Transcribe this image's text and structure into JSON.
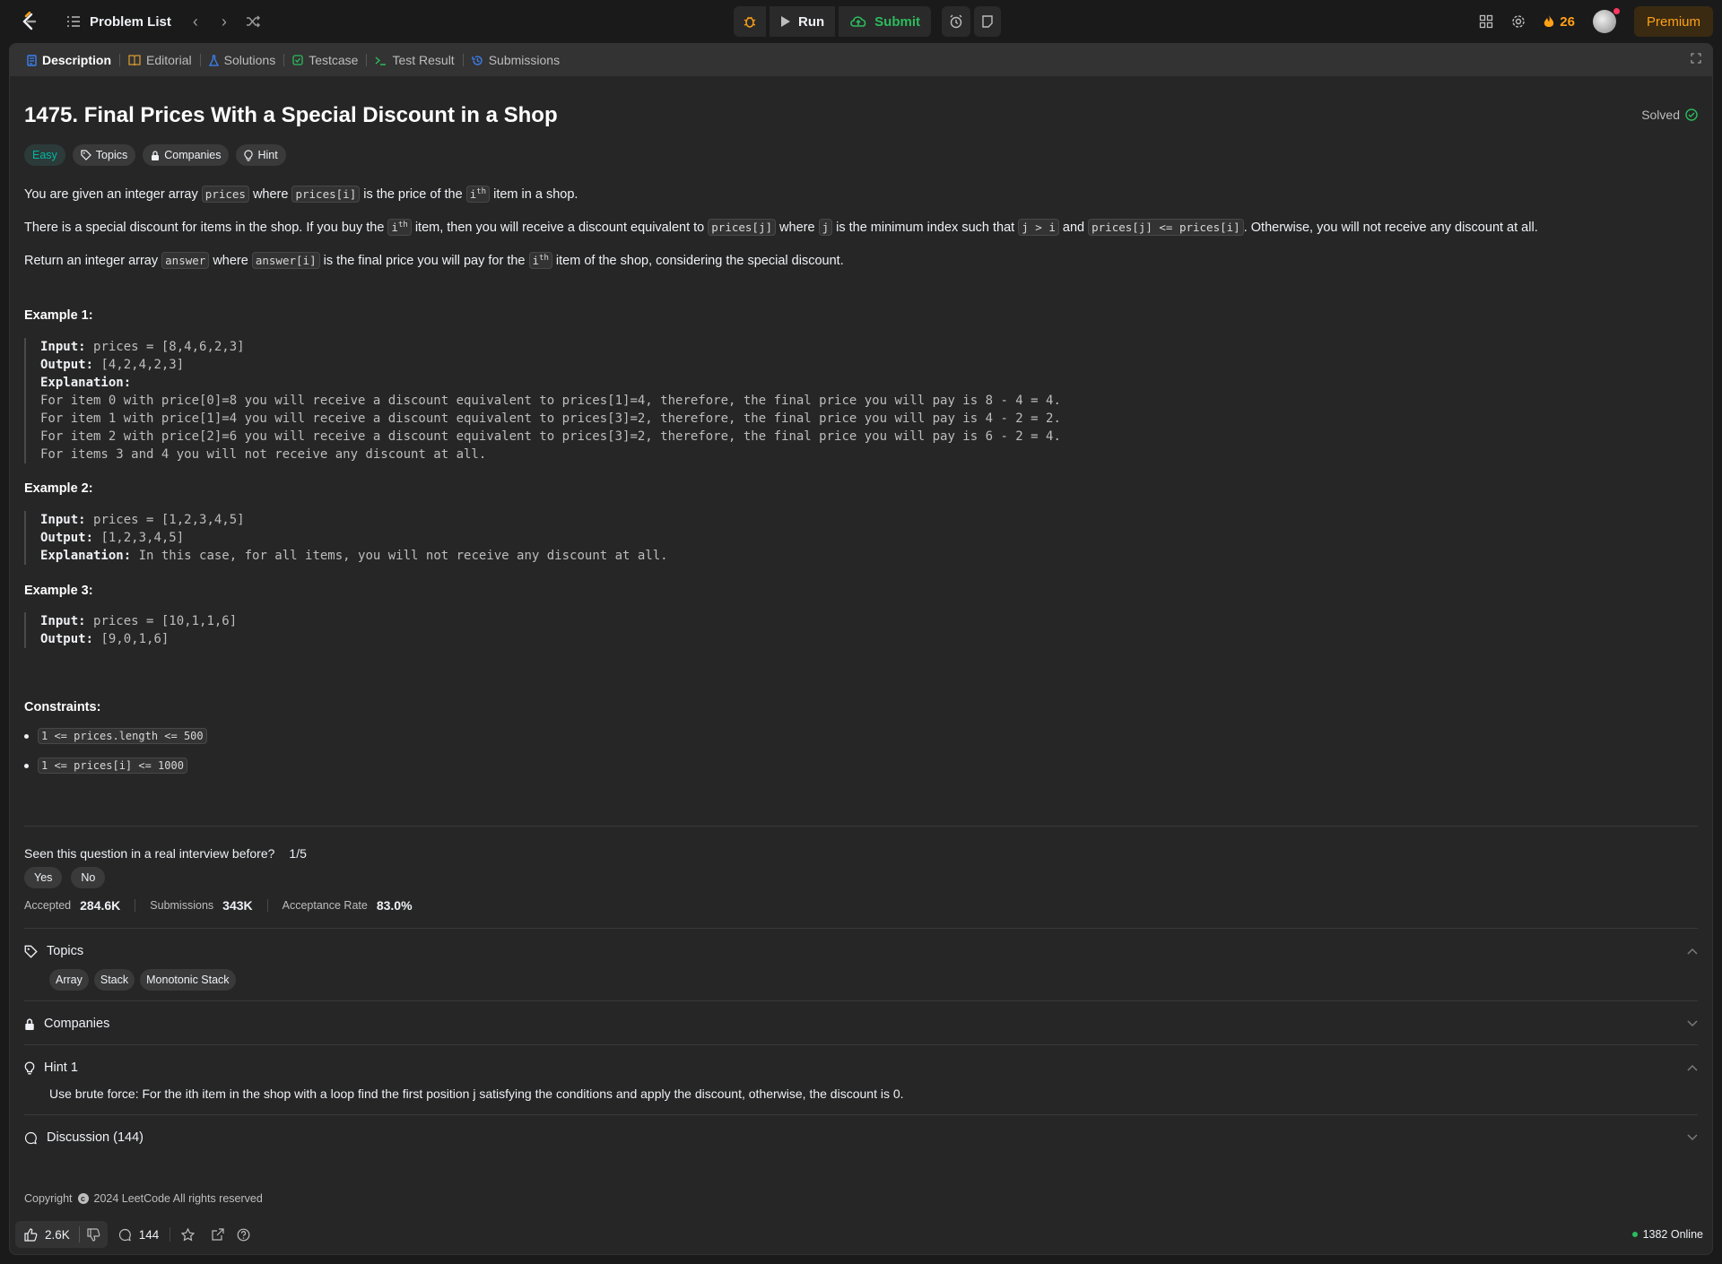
{
  "topbar": {
    "problem_list_label": "Problem List",
    "run_label": "Run",
    "submit_label": "Submit",
    "streak_count": "26",
    "premium_label": "Premium"
  },
  "tabs": [
    {
      "label": "Description",
      "icon": "description-icon",
      "active": true
    },
    {
      "label": "Editorial",
      "icon": "book-icon"
    },
    {
      "label": "Solutions",
      "icon": "flask-icon"
    },
    {
      "label": "Testcase",
      "icon": "checkbox-icon"
    },
    {
      "label": "Test Result",
      "icon": "terminal-icon"
    },
    {
      "label": "Submissions",
      "icon": "history-icon"
    }
  ],
  "problem": {
    "title": "1475. Final Prices With a Special Discount in a Shop",
    "solved_label": "Solved",
    "difficulty": "Easy",
    "badges": {
      "topics": "Topics",
      "companies": "Companies",
      "hint": "Hint"
    },
    "p1": {
      "a": "You are given an integer array",
      "c1": "prices",
      "b": "where",
      "c2": "prices[i]",
      "c": "is the price of the",
      "c3": "i",
      "sup": "th",
      "d": "item in a shop."
    },
    "p2": {
      "a": "There is a special discount for items in the shop. If you buy the",
      "c1": "i",
      "sup": "th",
      "b": "item, then you will receive a discount equivalent to",
      "c2": "prices[j]",
      "c": "where",
      "c3": "j",
      "d": "is the minimum index such that",
      "c4": "j > i",
      "e": "and",
      "c5": "prices[j] <= prices[i]",
      "f": ". Otherwise, you will not receive any discount at all."
    },
    "p3": {
      "a": "Return an integer array",
      "c1": "answer",
      "b": "where",
      "c2": "answer[i]",
      "c": "is the final price you will pay for the",
      "c3": "i",
      "sup": "th",
      "d": "item of the shop, considering the special discount."
    }
  },
  "examples": [
    {
      "title": "Example 1:",
      "input_label": "Input:",
      "input": "prices = [8,4,6,2,3]",
      "output_label": "Output:",
      "output": "[4,2,4,2,3]",
      "explanation_label": "Explanation:",
      "explanation_lines": [
        "For item 0 with price[0]=8 you will receive a discount equivalent to prices[1]=4, therefore, the final price you will pay is 8 - 4 = 4.",
        "For item 1 with price[1]=4 you will receive a discount equivalent to prices[3]=2, therefore, the final price you will pay is 4 - 2 = 2.",
        "For item 2 with price[2]=6 you will receive a discount equivalent to prices[3]=2, therefore, the final price you will pay is 6 - 2 = 4.",
        "For items 3 and 4 you will not receive any discount at all."
      ]
    },
    {
      "title": "Example 2:",
      "input_label": "Input:",
      "input": "prices = [1,2,3,4,5]",
      "output_label": "Output:",
      "output": "[1,2,3,4,5]",
      "explanation_label": "Explanation:",
      "explanation": "In this case, for all items, you will not receive any discount at all."
    },
    {
      "title": "Example 3:",
      "input_label": "Input:",
      "input": "prices = [10,1,1,6]",
      "output_label": "Output:",
      "output": "[9,0,1,6]"
    }
  ],
  "constraints": {
    "title": "Constraints:",
    "items": [
      "1 <= prices.length <= 500",
      "1 <= prices[i] <= 1000"
    ]
  },
  "interview": {
    "question": "Seen this question in a real interview before?",
    "ratio": "1/5",
    "yes": "Yes",
    "no": "No"
  },
  "stats": {
    "accepted_label": "Accepted",
    "accepted": "284.6K",
    "submissions_label": "Submissions",
    "submissions": "343K",
    "rate_label": "Acceptance Rate",
    "rate": "83.0%"
  },
  "sections": {
    "topics": {
      "label": "Topics",
      "items": [
        "Array",
        "Stack",
        "Monotonic Stack"
      ]
    },
    "companies": {
      "label": "Companies"
    },
    "hint": {
      "label": "Hint 1",
      "text": "Use brute force: For the ith item in the shop with a loop find the first position j satisfying the conditions and apply the discount, otherwise, the discount is 0."
    },
    "discussion": {
      "label": "Discussion (144)"
    }
  },
  "copyright": {
    "prefix": "Copyright",
    "text": "2024 LeetCode All rights reserved"
  },
  "bottombar": {
    "likes": "2.6K",
    "comments": "144",
    "online": "1382 Online"
  },
  "colors": {
    "accent": "#ffa116",
    "easy": "#00b8a3",
    "success": "#2cbb5d",
    "panel": "#262626",
    "background": "#1a1a1a"
  }
}
